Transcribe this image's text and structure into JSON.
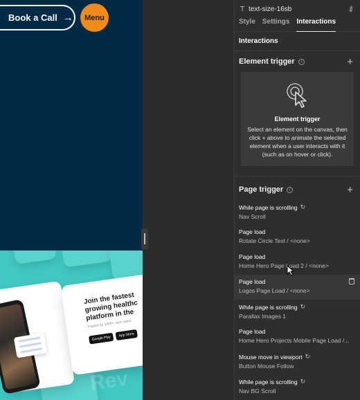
{
  "canvas": {
    "book_label": "Book a Call",
    "menu_label": "Menu",
    "hero_card_title": "Join the fastest growing healthc platform in the",
    "hero_card_sub": "Trusted by 1000+ care users",
    "store_google": "Google Play",
    "store_apple": "App Store",
    "watermark": "Rev"
  },
  "panel": {
    "element_name": "text-size-16sb",
    "tabs": [
      "Style",
      "Settings",
      "Interactions"
    ],
    "active_tab": "Interactions",
    "section_title": "Interactions",
    "element_trigger": {
      "title": "Element trigger",
      "box_title": "Element trigger",
      "box_desc": "Select an element on the canvas, then click + above to animate the selected element when a user interacts with it (such as on hover or click)."
    },
    "page_trigger": {
      "title": "Page trigger",
      "items": [
        {
          "title": "While page is scrolling",
          "sub": "Nav Scroll",
          "icon": "loop-icon"
        },
        {
          "title": "Page load",
          "sub": "Rotate Circle Text / <none>"
        },
        {
          "title": "Page load",
          "sub": "Home Hero Page Load 2 / <none>"
        },
        {
          "title": "Page load",
          "sub": "Logos Page Load / <none>",
          "highlighted": true
        },
        {
          "title": "While page is scrolling",
          "sub": "Parallax Images 1",
          "icon": "loop-icon"
        },
        {
          "title": "Page load",
          "sub": "Home Hero Projects Mobile Page Load /..."
        },
        {
          "title": "Mouse move in viewport",
          "sub": "Button Mouse Follow",
          "icon": "loop-icon"
        },
        {
          "title": "While page is scrolling",
          "sub": "Nav BG Scroll",
          "icon": "loop-icon"
        }
      ]
    }
  },
  "colors": {
    "canvas_bg": "#032a45",
    "menu_orange": "#f08a18",
    "hero_teal": "#41c8c4",
    "panel_bg": "#2e2e2e"
  }
}
